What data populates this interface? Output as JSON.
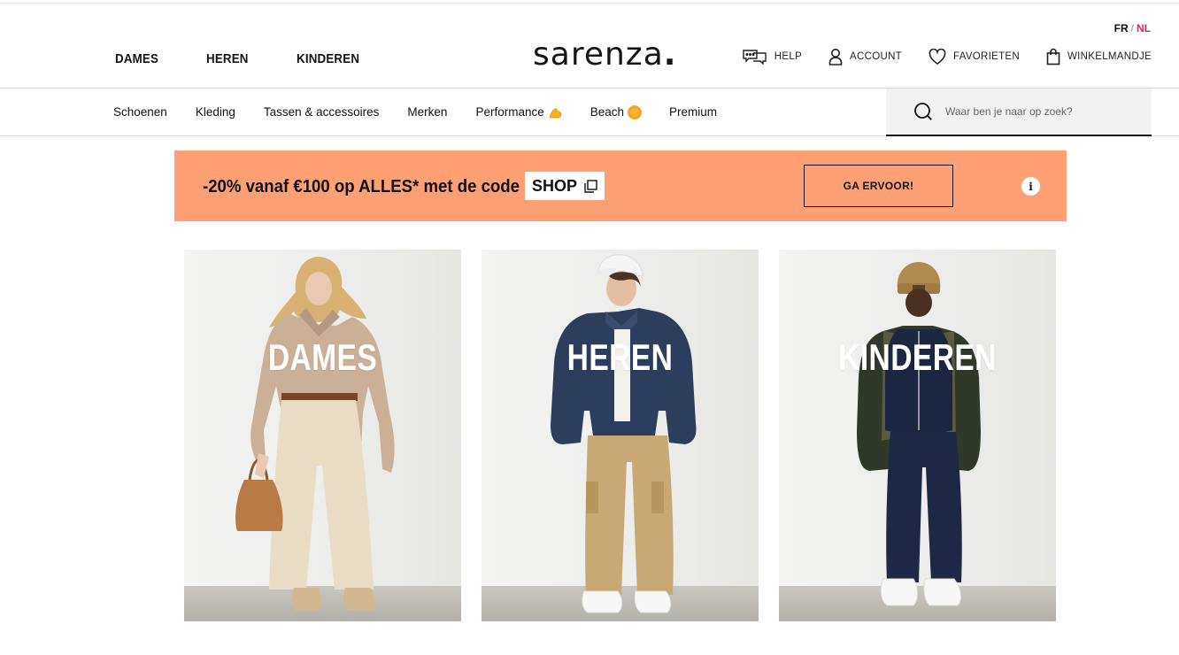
{
  "language": {
    "fr": "FR",
    "separator": "/",
    "nl": "NL"
  },
  "gender_nav": [
    "DAMES",
    "HEREN",
    "KINDEREN"
  ],
  "logo": {
    "text": "sarenza",
    "dot": "."
  },
  "utilities": [
    {
      "label": "HELP",
      "icon": "chat-icon"
    },
    {
      "label": "ACCOUNT",
      "icon": "user-icon"
    },
    {
      "label": "FAVORIETEN",
      "icon": "heart-icon"
    },
    {
      "label": "WINKELMANDJE",
      "icon": "bag-icon"
    }
  ],
  "categories": [
    {
      "label": "Schoenen"
    },
    {
      "label": "Kleding"
    },
    {
      "label": "Tassen & accessoires"
    },
    {
      "label": "Merken"
    },
    {
      "label": "Performance",
      "icon": "flexed-biceps-emoji"
    },
    {
      "label": "Beach",
      "icon": "sun-emoji"
    },
    {
      "label": "Premium"
    }
  ],
  "search": {
    "placeholder": "Waar ben je naar op zoek?",
    "icon": "search-icon"
  },
  "promo": {
    "text": "-20% vanaf €100 op ALLES* met de code",
    "code": "SHOP",
    "button": "GA ERVOOR!",
    "info": "i",
    "background": "#ff9f74"
  },
  "tiles": [
    {
      "label": "DAMES"
    },
    {
      "label": "HEREN"
    },
    {
      "label": "KINDEREN"
    }
  ],
  "colors": {
    "accent_nl": "#e5255f",
    "text": "#111111"
  }
}
